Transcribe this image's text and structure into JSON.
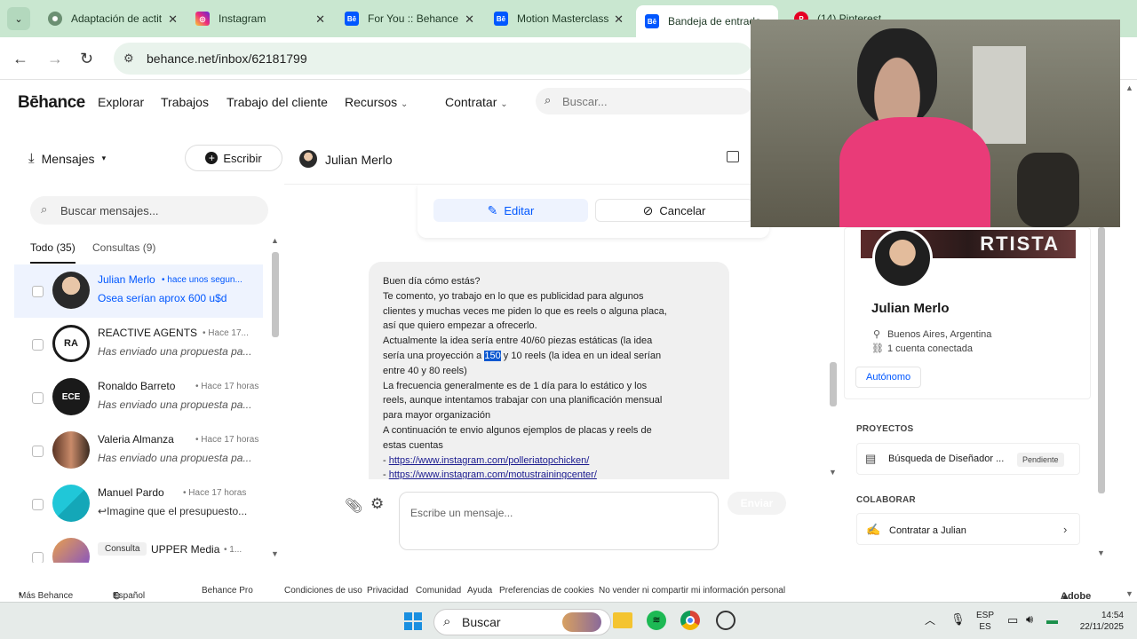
{
  "browser": {
    "tabs": [
      {
        "title": "Adaptación de actit",
        "icon": "chatgpt-icon",
        "color": "#6b8f72"
      },
      {
        "title": "Instagram",
        "icon": "instagram-icon",
        "color": "#d6249f"
      },
      {
        "title": "For You :: Behance",
        "icon": "behance-icon",
        "color": "#0057ff"
      },
      {
        "title": "Motion Masterclass",
        "icon": "behance-icon",
        "color": "#0057ff"
      },
      {
        "title": "Bandeja de entrada",
        "icon": "behance-icon",
        "color": "#0057ff"
      },
      {
        "title": "(14) Pinterest",
        "icon": "pinterest-icon",
        "color": "#e60023"
      }
    ],
    "url": "behance.net/inbox/62181799"
  },
  "header": {
    "logo": "Bēhance",
    "nav": [
      "Explorar",
      "Trabajos",
      "Trabajo del cliente",
      "Recursos",
      "Contratar"
    ],
    "search_placeholder": "Buscar..."
  },
  "sidebar": {
    "title": "Mensajes",
    "compose_label": "Escribir",
    "search_placeholder": "Buscar mensajes...",
    "filters": [
      "Todo (35)",
      "Consultas (9)"
    ],
    "conversations": [
      {
        "name": "Julian Merlo",
        "time": "hace unos segun...",
        "preview": "Osea serían aprox 600 u$d",
        "selected": true,
        "avatar_color": "#3b3b3b"
      },
      {
        "name": "REACTIVE AGENTS",
        "time": "Hace 17...",
        "preview": "Has enviado una propuesta pa...",
        "avatar_color": "#1a1a1a"
      },
      {
        "name": "Ronaldo Barreto",
        "time": "Hace 17 horas",
        "preview": "Has enviado una propuesta pa...",
        "avatar_color": "#1a1a1a"
      },
      {
        "name": "Valeria Almanza",
        "time": "Hace 17 horas",
        "preview": "Has enviado una propuesta pa...",
        "avatar_color": "#8a4a3a"
      },
      {
        "name": "Manuel Pardo",
        "time": "Hace 17 horas",
        "preview": "Imagine que el presupuesto...",
        "avatar_color": "#1fb8c9"
      },
      {
        "name": "UPPER Media",
        "badge": "Consulta",
        "time": "1...",
        "preview": "",
        "avatar_color": "#e0a050"
      }
    ]
  },
  "chat": {
    "contact_name": "Julian Merlo",
    "edit_label": "Editar",
    "cancel_label": "Cancelar",
    "message_lines": [
      "Buen día cómo estás?",
      "Te comento, yo trabajo en lo que es publicidad para algunos",
      "clientes y muchas veces me piden lo que es reels o alguna placa,",
      "así que quiero empezar a ofrecerlo.",
      "Actualmente la idea sería entre 40/60 piezas estáticas (la idea",
      "entre 40 y 80 reels)",
      "La frecuencia generalmente es de 1 día para lo estático y los",
      "reels, aunque intentamos trabajar con una planificación mensual",
      "para mayor organización",
      "A continuación te envio algunos ejemplos de placas y reels de",
      "estas cuentas"
    ],
    "line6_before": "sería una proyección a ",
    "line6_highlight": "150",
    "line6_after": " y 10 reels (la idea en un ideal serían",
    "links": [
      "https://www.instagram.com/polleriatopchicken/",
      "https://www.instagram.com/motustrainingcenter/"
    ],
    "link_prefix": "- ",
    "composer_placeholder": "Escribe un mensaje...",
    "send_label": "Enviar"
  },
  "profile": {
    "name": "Julian Merlo",
    "location": "Buenos Aires, Argentina",
    "connected": "1 cuenta conectada",
    "tag": "Autónomo",
    "banner_text": "RTISTA",
    "projects_title": "PROYECTOS",
    "project_name": "Búsqueda de Diseñador ...",
    "project_status": "Pendiente",
    "collab_title": "COLABORAR",
    "hire_label": "Contratar a Julian"
  },
  "footer": {
    "items": [
      "Más Behance",
      "Español",
      "Behance Pro",
      "Condiciones de uso",
      "Privacidad",
      "Comunidad",
      "Ayuda",
      "Preferencias de cookies",
      "No vender ni compartir mi información personal"
    ],
    "adobe": "Adobe"
  },
  "taskbar": {
    "search": "Buscar",
    "lang_top": "ESP",
    "lang_bottom": "ES",
    "time": "14:54",
    "date": "22/11/2025"
  }
}
